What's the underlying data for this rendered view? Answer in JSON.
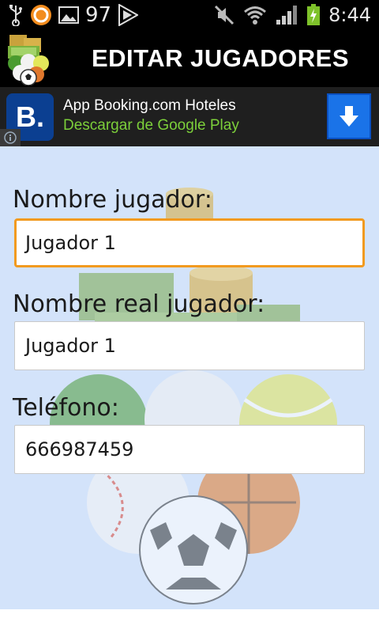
{
  "status_bar": {
    "notification_count": "97",
    "time": "8:44",
    "icons": [
      "usb-icon",
      "app-notification-icon",
      "image-icon",
      "play-store-icon",
      "mute-icon",
      "wifi-icon",
      "signal-icon",
      "battery-icon"
    ]
  },
  "title_bar": {
    "title": "EDITAR JUGADORES"
  },
  "ad": {
    "logo_letter": "B.",
    "title": "App Booking.com Hoteles",
    "subtitle": "Descargar de Google Play"
  },
  "form": {
    "fields": [
      {
        "label": "Nombre jugador:",
        "value": "Jugador 1",
        "focused": true
      },
      {
        "label": "Nombre real jugador:",
        "value": "Jugador 1",
        "focused": false
      },
      {
        "label": "Teléfono:",
        "value": "666987459",
        "focused": false
      }
    ]
  },
  "colors": {
    "content_background": "#d3e3fa",
    "focus_border": "#f29a1f",
    "ad_subtitle": "#7ccf3a",
    "ad_button": "#1a73e8"
  }
}
